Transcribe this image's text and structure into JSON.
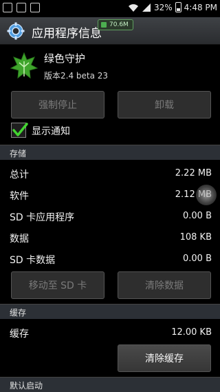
{
  "status_bar": {
    "battery": "32%",
    "time": "4:48 PM",
    "left_icons": [
      "usb-icon",
      "image-icon",
      "sd-card-icon"
    ],
    "right_icons": [
      "wifi-icon",
      "signal-icon",
      "battery-icon"
    ]
  },
  "title_bar": {
    "title": "应用程序信息",
    "memory_badge": "70.6M",
    "icon": "settings-gear-icon"
  },
  "app": {
    "name": "绿色守护",
    "version": "版本2.4 beta 23",
    "icon": "green-leaf-icon"
  },
  "actions": {
    "force_stop": "强制停止",
    "uninstall": "卸载"
  },
  "notification": {
    "label": "显示通知",
    "checked": true
  },
  "storage": {
    "header": "存储",
    "rows": [
      {
        "label": "总计",
        "value": "2.22 MB"
      },
      {
        "label": "软件",
        "value": "2.12 MB"
      },
      {
        "label": "SD 卡应用程序",
        "value": "0.00 B"
      },
      {
        "label": "数据",
        "value": "108 KB"
      },
      {
        "label": "SD 卡数据",
        "value": "0.00 B"
      }
    ],
    "move_to_sd": "移动至 SD 卡",
    "clear_data": "清除数据"
  },
  "cache": {
    "header": "缓存",
    "label": "缓存",
    "value": "12.00 KB",
    "clear_cache": "清除缓存"
  },
  "launch_default": {
    "header": "默认启动"
  },
  "colors": {
    "check_green": "#43d431",
    "leaf_green": "#3fa52c"
  }
}
